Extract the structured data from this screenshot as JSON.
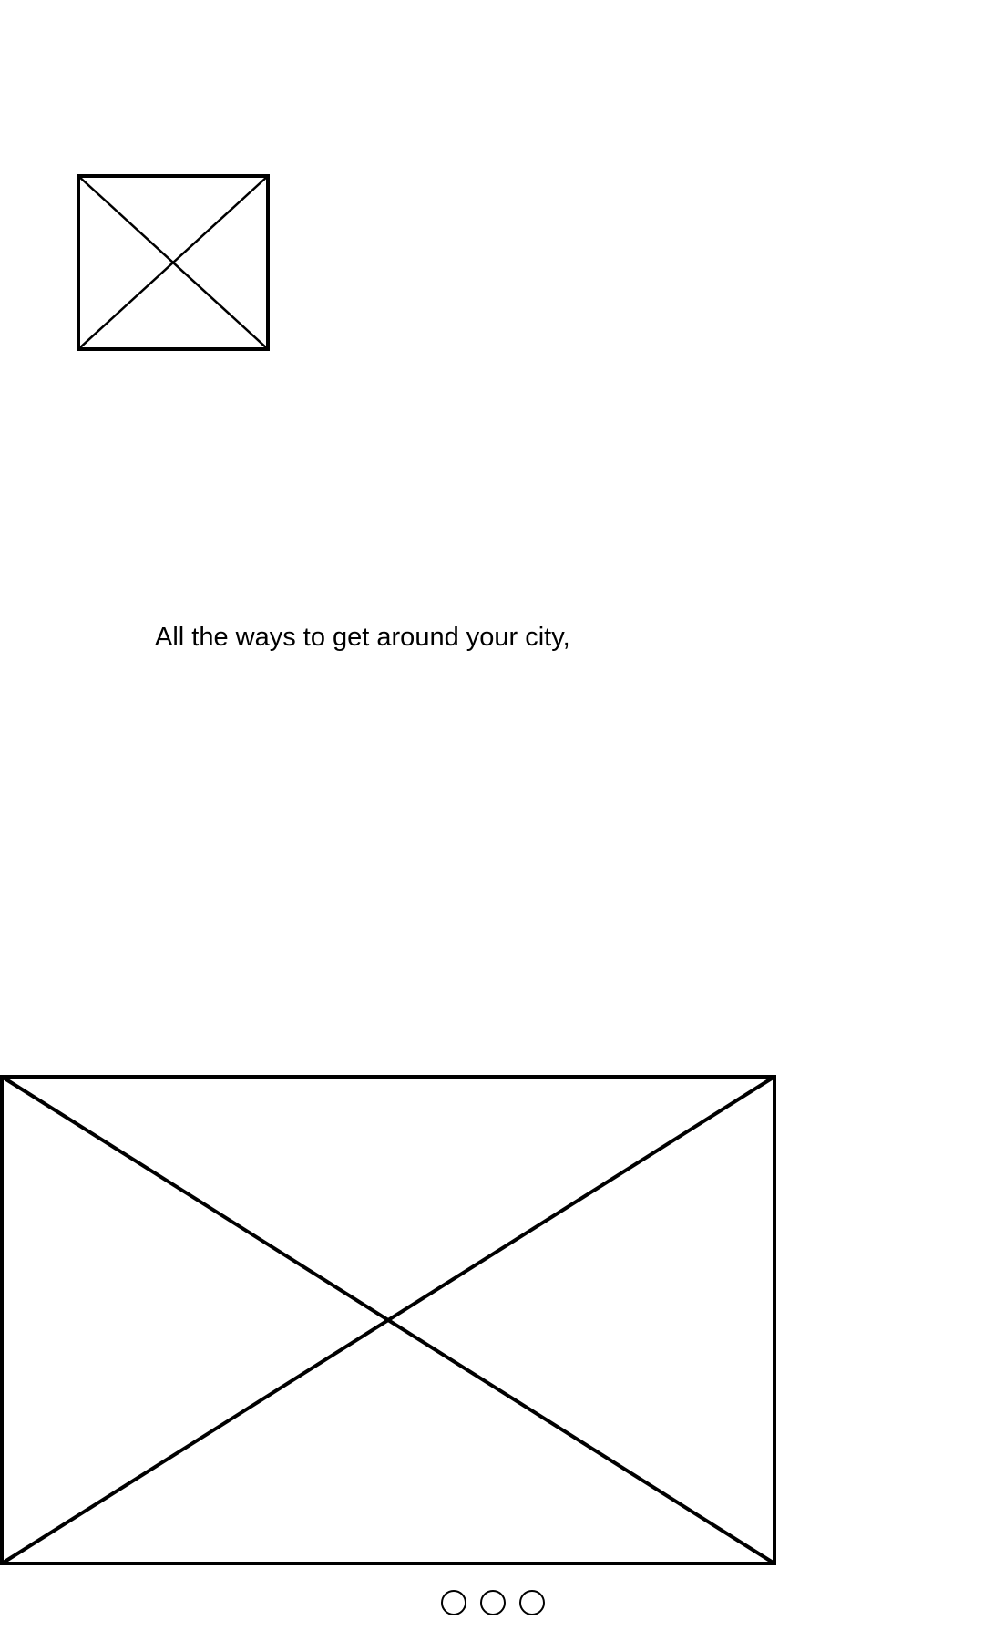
{
  "onboarding": {
    "tagline": "All the ways to get around your city,",
    "logo": {
      "icon": "image-placeholder-icon"
    },
    "hero": {
      "icon": "image-placeholder-icon"
    },
    "pager": {
      "page_count": 3,
      "dots": [
        "page-1",
        "page-2",
        "page-3"
      ]
    },
    "colors": {
      "background": "#ffffff",
      "stroke": "#000000",
      "text": "#000000"
    }
  }
}
